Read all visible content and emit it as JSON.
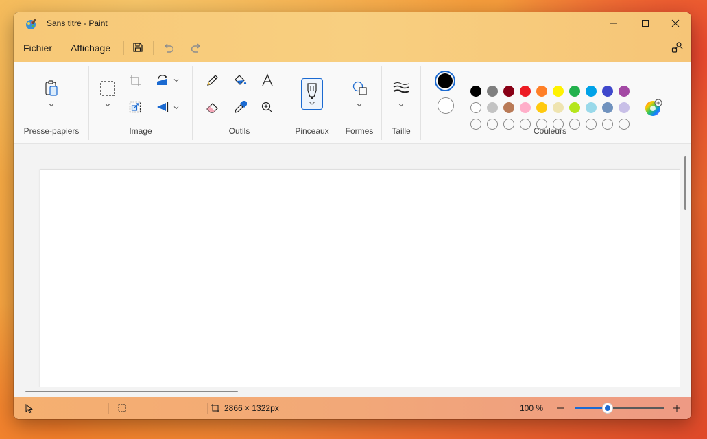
{
  "window": {
    "title": "Sans titre - Paint"
  },
  "menu": {
    "file": "Fichier",
    "view": "Affichage"
  },
  "ribbon": {
    "groups": {
      "clipboard": "Presse-papiers",
      "image": "Image",
      "tools": "Outils",
      "brushes": "Pinceaux",
      "shapes": "Formes",
      "size": "Taille",
      "colors": "Couleurs"
    }
  },
  "colors": {
    "primary": "#000000",
    "secondary": "#ffffff",
    "palette_row1": [
      "#000000",
      "#7f7f7f",
      "#880015",
      "#ed1c24",
      "#ff7f27",
      "#fff200",
      "#22b14c",
      "#00a2e8",
      "#3f48cc",
      "#a349a4"
    ],
    "palette_row2": [
      "#ffffff",
      "#c3c3c3",
      "#b97a57",
      "#ffaec9",
      "#ffc90e",
      "#efe4b0",
      "#b5e61d",
      "#99d9ea",
      "#7092be",
      "#c8bfe7"
    ],
    "palette_row3_empty": 10
  },
  "status": {
    "canvas_size": "2866 × 1322px",
    "zoom": "100 %",
    "zoom_fraction": 0.37
  }
}
